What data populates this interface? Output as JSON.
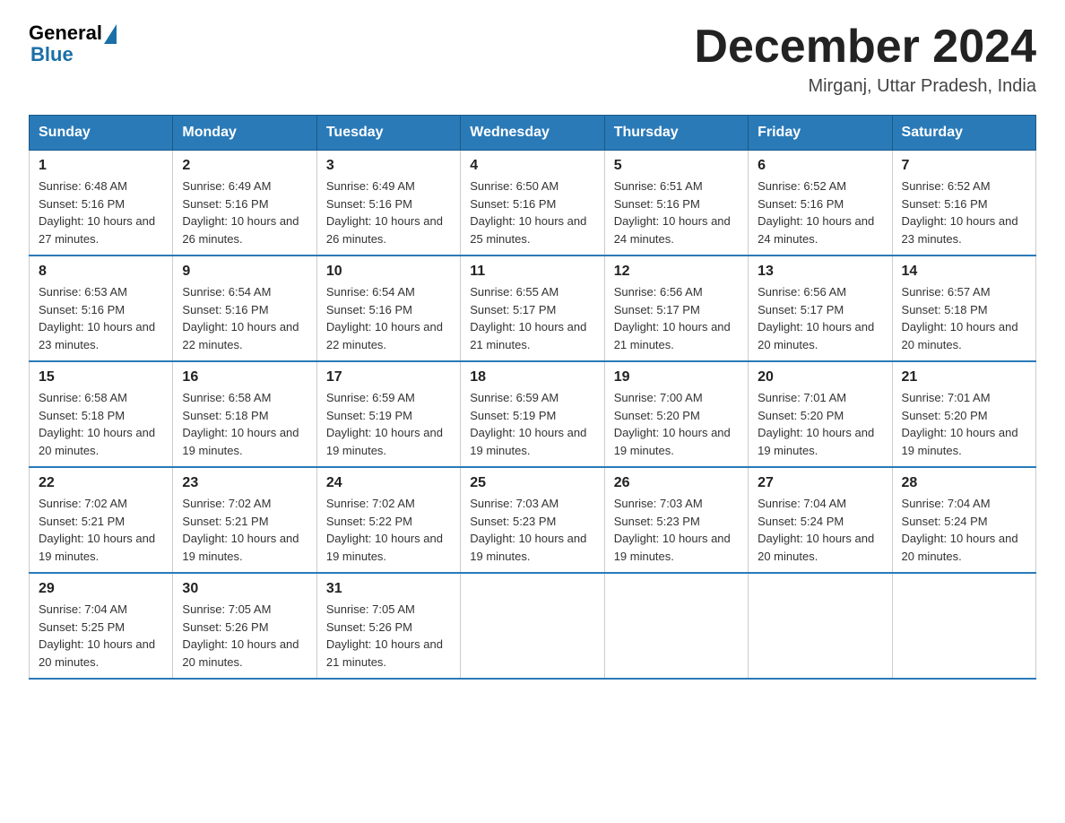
{
  "header": {
    "logo_general": "General",
    "logo_blue": "Blue",
    "month_title": "December 2024",
    "subtitle": "Mirganj, Uttar Pradesh, India"
  },
  "weekdays": [
    "Sunday",
    "Monday",
    "Tuesday",
    "Wednesday",
    "Thursday",
    "Friday",
    "Saturday"
  ],
  "weeks": [
    [
      {
        "day": "1",
        "sunrise": "6:48 AM",
        "sunset": "5:16 PM",
        "daylight": "10 hours and 27 minutes."
      },
      {
        "day": "2",
        "sunrise": "6:49 AM",
        "sunset": "5:16 PM",
        "daylight": "10 hours and 26 minutes."
      },
      {
        "day": "3",
        "sunrise": "6:49 AM",
        "sunset": "5:16 PM",
        "daylight": "10 hours and 26 minutes."
      },
      {
        "day": "4",
        "sunrise": "6:50 AM",
        "sunset": "5:16 PM",
        "daylight": "10 hours and 25 minutes."
      },
      {
        "day": "5",
        "sunrise": "6:51 AM",
        "sunset": "5:16 PM",
        "daylight": "10 hours and 24 minutes."
      },
      {
        "day": "6",
        "sunrise": "6:52 AM",
        "sunset": "5:16 PM",
        "daylight": "10 hours and 24 minutes."
      },
      {
        "day": "7",
        "sunrise": "6:52 AM",
        "sunset": "5:16 PM",
        "daylight": "10 hours and 23 minutes."
      }
    ],
    [
      {
        "day": "8",
        "sunrise": "6:53 AM",
        "sunset": "5:16 PM",
        "daylight": "10 hours and 23 minutes."
      },
      {
        "day": "9",
        "sunrise": "6:54 AM",
        "sunset": "5:16 PM",
        "daylight": "10 hours and 22 minutes."
      },
      {
        "day": "10",
        "sunrise": "6:54 AM",
        "sunset": "5:16 PM",
        "daylight": "10 hours and 22 minutes."
      },
      {
        "day": "11",
        "sunrise": "6:55 AM",
        "sunset": "5:17 PM",
        "daylight": "10 hours and 21 minutes."
      },
      {
        "day": "12",
        "sunrise": "6:56 AM",
        "sunset": "5:17 PM",
        "daylight": "10 hours and 21 minutes."
      },
      {
        "day": "13",
        "sunrise": "6:56 AM",
        "sunset": "5:17 PM",
        "daylight": "10 hours and 20 minutes."
      },
      {
        "day": "14",
        "sunrise": "6:57 AM",
        "sunset": "5:18 PM",
        "daylight": "10 hours and 20 minutes."
      }
    ],
    [
      {
        "day": "15",
        "sunrise": "6:58 AM",
        "sunset": "5:18 PM",
        "daylight": "10 hours and 20 minutes."
      },
      {
        "day": "16",
        "sunrise": "6:58 AM",
        "sunset": "5:18 PM",
        "daylight": "10 hours and 19 minutes."
      },
      {
        "day": "17",
        "sunrise": "6:59 AM",
        "sunset": "5:19 PM",
        "daylight": "10 hours and 19 minutes."
      },
      {
        "day": "18",
        "sunrise": "6:59 AM",
        "sunset": "5:19 PM",
        "daylight": "10 hours and 19 minutes."
      },
      {
        "day": "19",
        "sunrise": "7:00 AM",
        "sunset": "5:20 PM",
        "daylight": "10 hours and 19 minutes."
      },
      {
        "day": "20",
        "sunrise": "7:01 AM",
        "sunset": "5:20 PM",
        "daylight": "10 hours and 19 minutes."
      },
      {
        "day": "21",
        "sunrise": "7:01 AM",
        "sunset": "5:20 PM",
        "daylight": "10 hours and 19 minutes."
      }
    ],
    [
      {
        "day": "22",
        "sunrise": "7:02 AM",
        "sunset": "5:21 PM",
        "daylight": "10 hours and 19 minutes."
      },
      {
        "day": "23",
        "sunrise": "7:02 AM",
        "sunset": "5:21 PM",
        "daylight": "10 hours and 19 minutes."
      },
      {
        "day": "24",
        "sunrise": "7:02 AM",
        "sunset": "5:22 PM",
        "daylight": "10 hours and 19 minutes."
      },
      {
        "day": "25",
        "sunrise": "7:03 AM",
        "sunset": "5:23 PM",
        "daylight": "10 hours and 19 minutes."
      },
      {
        "day": "26",
        "sunrise": "7:03 AM",
        "sunset": "5:23 PM",
        "daylight": "10 hours and 19 minutes."
      },
      {
        "day": "27",
        "sunrise": "7:04 AM",
        "sunset": "5:24 PM",
        "daylight": "10 hours and 20 minutes."
      },
      {
        "day": "28",
        "sunrise": "7:04 AM",
        "sunset": "5:24 PM",
        "daylight": "10 hours and 20 minutes."
      }
    ],
    [
      {
        "day": "29",
        "sunrise": "7:04 AM",
        "sunset": "5:25 PM",
        "daylight": "10 hours and 20 minutes."
      },
      {
        "day": "30",
        "sunrise": "7:05 AM",
        "sunset": "5:26 PM",
        "daylight": "10 hours and 20 minutes."
      },
      {
        "day": "31",
        "sunrise": "7:05 AM",
        "sunset": "5:26 PM",
        "daylight": "10 hours and 21 minutes."
      },
      null,
      null,
      null,
      null
    ]
  ]
}
